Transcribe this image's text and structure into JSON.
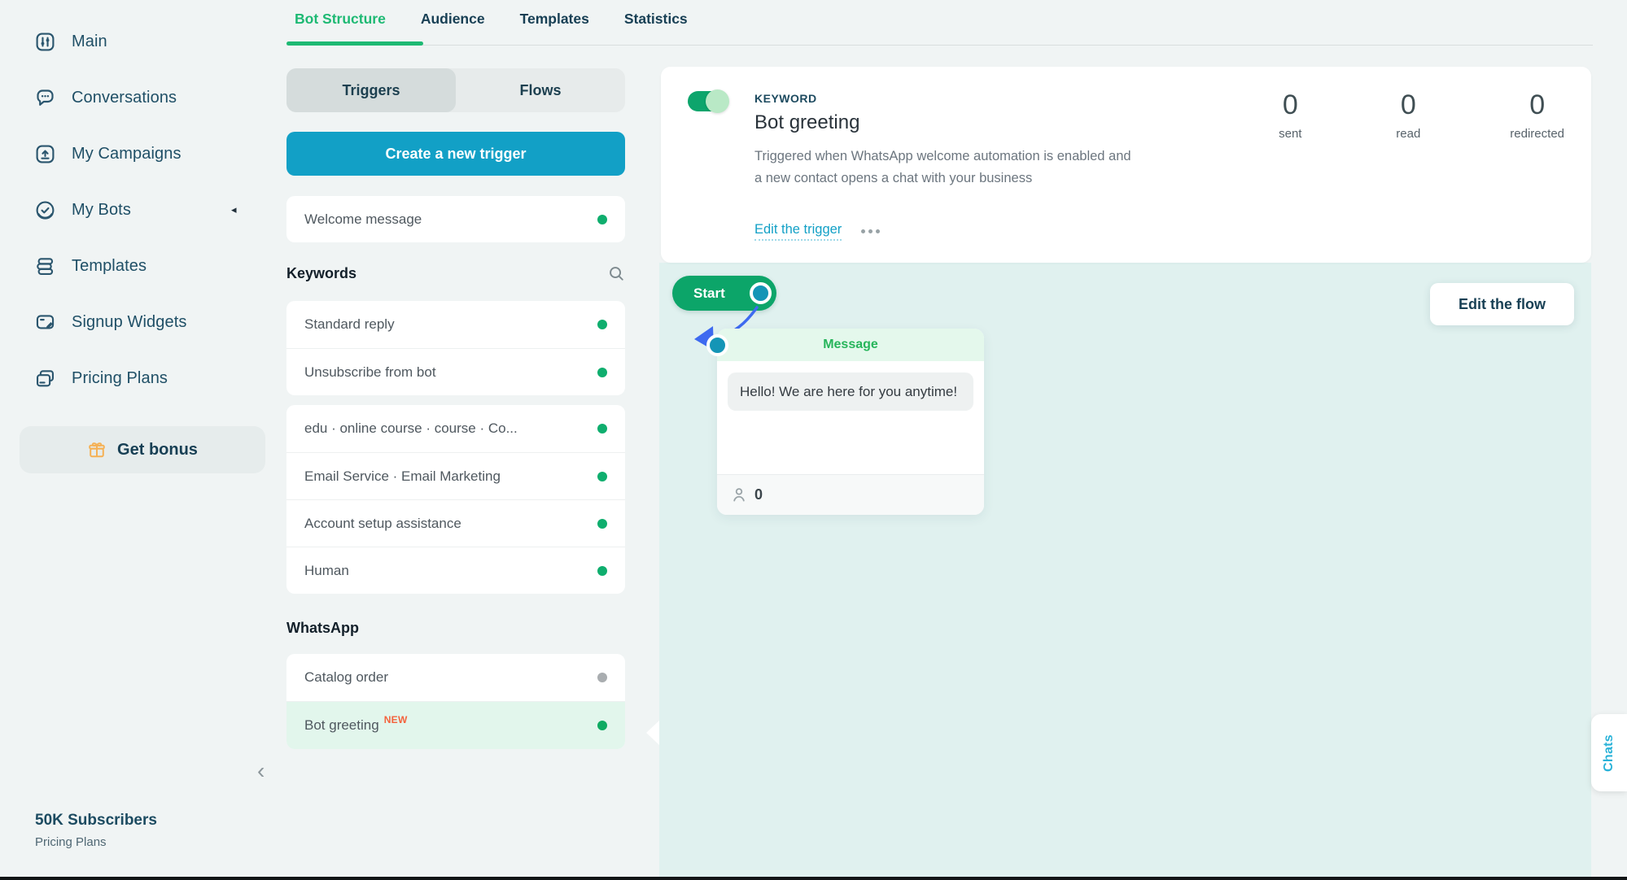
{
  "colors": {
    "accent_green": "#1db973",
    "accent_cyan": "#12a0c6",
    "canvas_mint": "#e0f1ef",
    "status_green": "#0fae6e",
    "status_gray": "#a9adb0",
    "new_badge": "#f4623c",
    "sidebar_text": "#1f4f66",
    "arrow_blue": "#3e6af0"
  },
  "sidebar": {
    "items": [
      {
        "label": "Main"
      },
      {
        "label": "Conversations"
      },
      {
        "label": "My Campaigns"
      },
      {
        "label": "My Bots"
      },
      {
        "label": "Templates"
      },
      {
        "label": "Signup Widgets"
      },
      {
        "label": "Pricing Plans"
      }
    ],
    "bonus_button": "Get bonus",
    "footer": {
      "title": "50K Subscribers",
      "subtitle": "Pricing Plans"
    }
  },
  "header": {
    "tabs": [
      {
        "label": "Bot Structure"
      },
      {
        "label": "Audience"
      },
      {
        "label": "Templates"
      },
      {
        "label": "Statistics"
      }
    ]
  },
  "panel": {
    "segments": [
      {
        "label": "Triggers"
      },
      {
        "label": "Flows"
      }
    ],
    "create_button": "Create a new trigger",
    "welcome_item": {
      "label": "Welcome message",
      "dot": "#0fae6e"
    },
    "keywords_heading": "Keywords",
    "keyword_items": [
      {
        "label": "Standard reply",
        "dot": "#0fae6e"
      },
      {
        "label": "Unsubscribe from bot",
        "dot": "#0fae6e"
      },
      {
        "label": "edu · online course · course · Co...",
        "dot": "#0fae6e"
      },
      {
        "label": "Email Service · Email Marketing",
        "dot": "#0fae6e"
      },
      {
        "label": "Account setup assistance",
        "dot": "#0fae6e"
      },
      {
        "label": "Human",
        "dot": "#0fae6e"
      }
    ],
    "whatsapp_heading": "WhatsApp",
    "whatsapp_items": [
      {
        "label": "Catalog order",
        "dot": "#a9adb0"
      },
      {
        "label": "Bot greeting",
        "badge": "NEW",
        "dot": "#0fab62"
      }
    ]
  },
  "keyword_card": {
    "type_label": "KEYWORD",
    "title": "Bot greeting",
    "description": "Triggered when WhatsApp welcome automation is enabled and a new contact opens a chat with your business",
    "edit_link": "Edit the trigger",
    "stats": [
      {
        "value": "0",
        "label": "sent"
      },
      {
        "value": "0",
        "label": "read"
      },
      {
        "value": "0",
        "label": "redirected"
      }
    ]
  },
  "flow": {
    "start_label": "Start",
    "node": {
      "type_label": "Message",
      "bubble_text": "Hello! We are here for you anytime!",
      "counter": "0"
    },
    "edit_flow_button": "Edit the flow"
  },
  "chats_tab": "Chats"
}
